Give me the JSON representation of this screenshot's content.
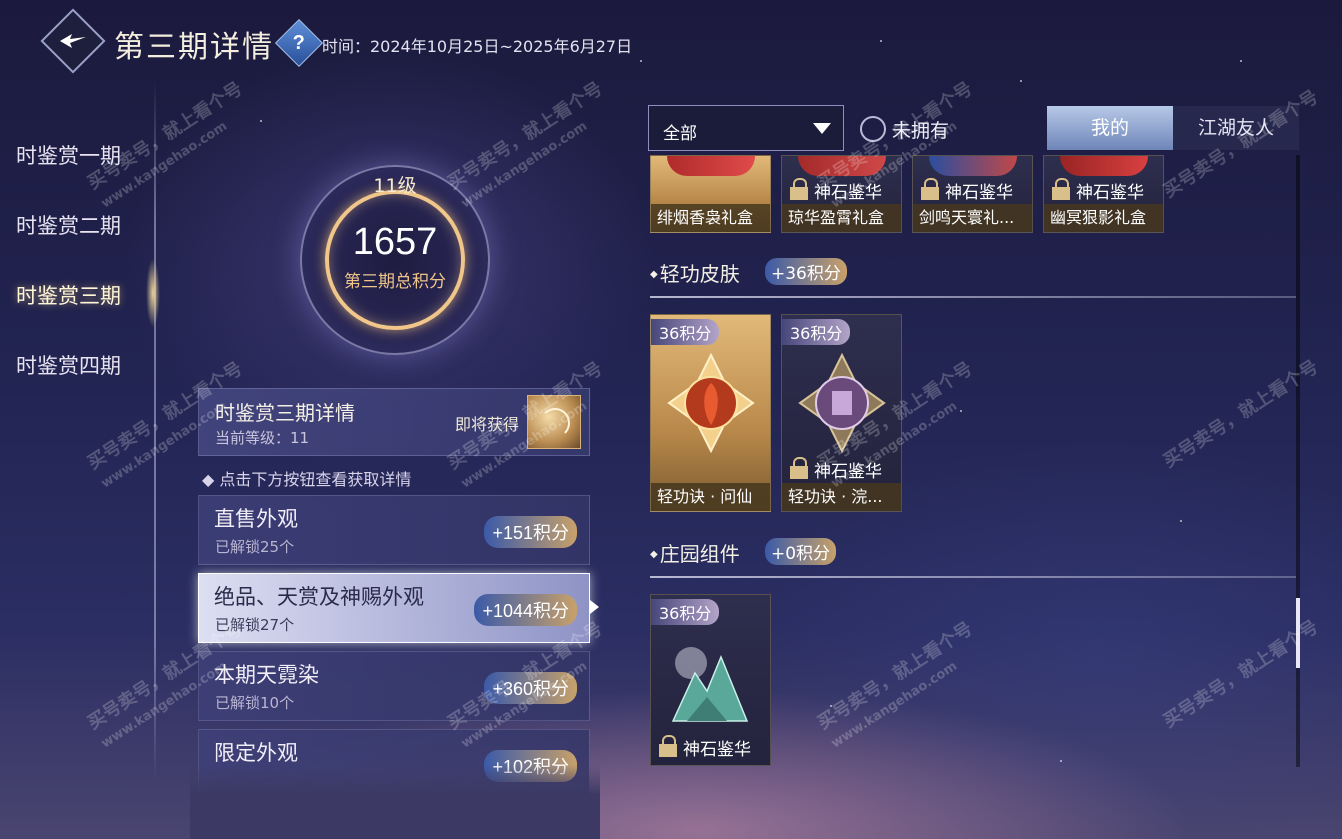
{
  "header": {
    "title": "第三期详情",
    "help_icon": "question-icon",
    "period_text": "时间：2024年10月25日~2025年6月27日"
  },
  "left_nav": {
    "items": [
      {
        "label": "时鉴赏一期"
      },
      {
        "label": "时鉴赏二期"
      },
      {
        "label": "时鉴赏三期",
        "active": true
      },
      {
        "label": "时鉴赏四期"
      }
    ]
  },
  "level": {
    "label": "11级",
    "score": "1657",
    "caption": "第三期总积分"
  },
  "detail_card": {
    "title": "时鉴赏三期详情",
    "current_level": "当前等级：11",
    "soon_label": "即将获得"
  },
  "hint": "点击下方按钮查看获取详情",
  "categories": [
    {
      "name": "直售外观",
      "unlocked": "已解锁25个",
      "points": "+151积分"
    },
    {
      "name": "绝品、天赏及神赐外观",
      "unlocked": "已解锁27个",
      "points": "+1044积分",
      "selected": true
    },
    {
      "name": "本期天霓染",
      "unlocked": "已解锁10个",
      "points": "+360积分"
    },
    {
      "name": "限定外观",
      "points": "+102积分"
    }
  ],
  "filter": {
    "selected": "全部",
    "unowned_label": "未拥有"
  },
  "tabs": {
    "mine": "我的",
    "friends": "江湖友人"
  },
  "top_items": [
    {
      "name": "绯烟香袅礼盒",
      "locked": false
    },
    {
      "name": "琼华盈霄礼盒",
      "locked": true,
      "source": "神石鉴华"
    },
    {
      "name": "剑鸣天寰礼...",
      "locked": true,
      "source": "神石鉴华"
    },
    {
      "name": "幽冥狠影礼盒",
      "locked": true,
      "source": "神石鉴华"
    }
  ],
  "sections": [
    {
      "title": "轻功皮肤",
      "points": "+36积分",
      "items": [
        {
          "name": "轻功诀 · 问仙",
          "tag": "36积分",
          "locked": false
        },
        {
          "name": "轻功诀 · 浣...",
          "tag": "36积分",
          "locked": true,
          "source": "神石鉴华"
        }
      ]
    },
    {
      "title": "庄园组件",
      "points": "+0积分",
      "items": [
        {
          "tag": "36积分",
          "locked": true,
          "source": "神石鉴华"
        }
      ]
    }
  ],
  "watermark": {
    "line1": "买号卖号，就上看个号",
    "line2": "www.kangehao.com",
    "line3": "看个号"
  },
  "colors": {
    "accent_gold": "#f0c68a",
    "bg_navy": "#1b1a3d",
    "pill_blue": "#3b5aa8"
  }
}
